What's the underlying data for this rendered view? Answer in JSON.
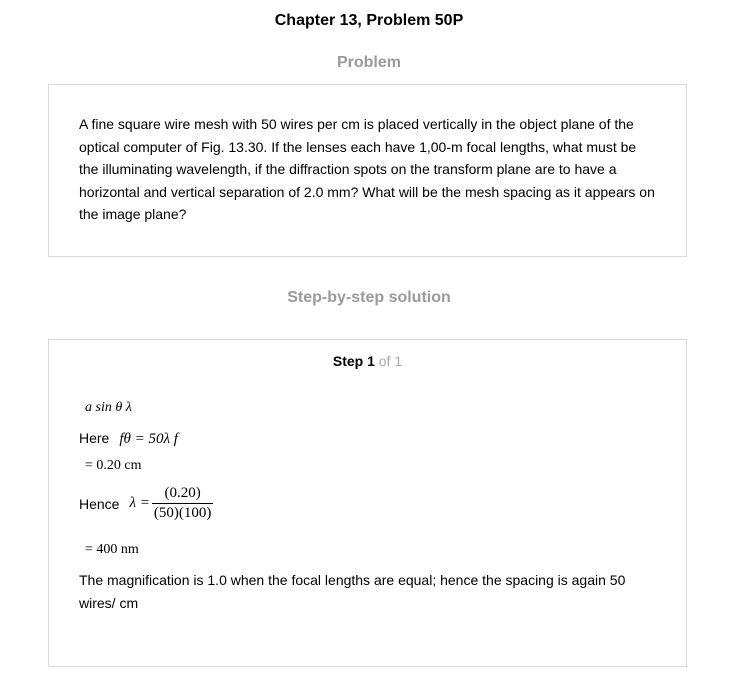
{
  "header": {
    "chapter_title": "Chapter 13, Problem 50P"
  },
  "problem": {
    "heading": "Problem",
    "text": "A fine square wire mesh with 50 wires per cm is placed vertically in the object plane of the optical computer of Fig. 13.30. If the lenses each have 1,00-m focal lengths, what must be the illuminating wavelength, if the diffraction spots on the transform plane are to have a horizontal and vertical separation of 2.0 mm? What will be the mesh spacing as it appears on the image plane?"
  },
  "solution": {
    "heading": "Step-by-step solution",
    "step_label": "Step 1",
    "step_of": "of 1",
    "eq1": "a sin θ  λ",
    "here_label": "Here",
    "eq2": "fθ = 50λ f",
    "eq3": "= 0.20 cm",
    "hence_label": "Hence",
    "eq4_lhs": "λ =",
    "eq4_num": "(0.20)",
    "eq4_den": "(50)(100)",
    "eq5": "= 400 nm",
    "conclusion": "The magnification is 1.0 when the focal lengths are equal; hence the spacing is again 50 wires/ cm"
  }
}
